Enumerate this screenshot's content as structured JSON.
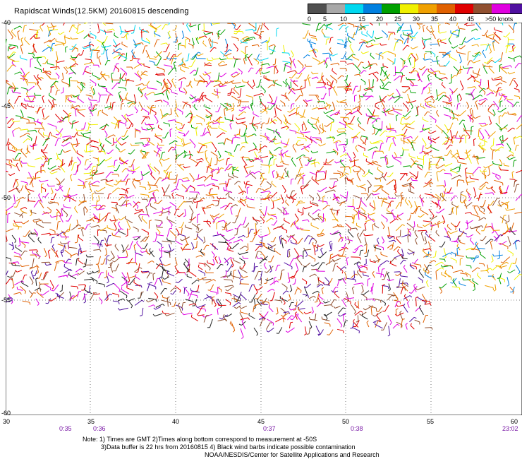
{
  "title": "Rapidscat Winds(12.5KM) 20160815 descending",
  "legend": {
    "colors": [
      "#505050",
      "#a8a8a8",
      "#00d8f0",
      "#0080e0",
      "#00a000",
      "#f0f000",
      "#f0a000",
      "#e06000",
      "#e00000",
      "#905030",
      "#e000e0",
      "#5010a0"
    ],
    "labels": [
      "0",
      "5",
      "10",
      "15",
      "20",
      "25",
      "30",
      "35",
      "40",
      "45",
      ">50 knots"
    ]
  },
  "lat_labels": [
    "-40",
    "-45",
    "-50",
    "-55",
    "-60"
  ],
  "lon_labels": [
    "30",
    "35",
    "40",
    "45",
    "50",
    "55",
    "60"
  ],
  "time_labels": [
    "0:35",
    "0:36",
    "0:37",
    "0:38",
    "23:02"
  ],
  "notes": {
    "line1": "Note: 1) Times are GMT 2)Times along bottom correspond to measurement at -50S",
    "line2": "3)Data buffer is 22 hrs from 20160815 4) Black wind barbs indicate possible contamination",
    "line3": "NOAA/NESDIS/Center for Satellite Applications and Research"
  }
}
